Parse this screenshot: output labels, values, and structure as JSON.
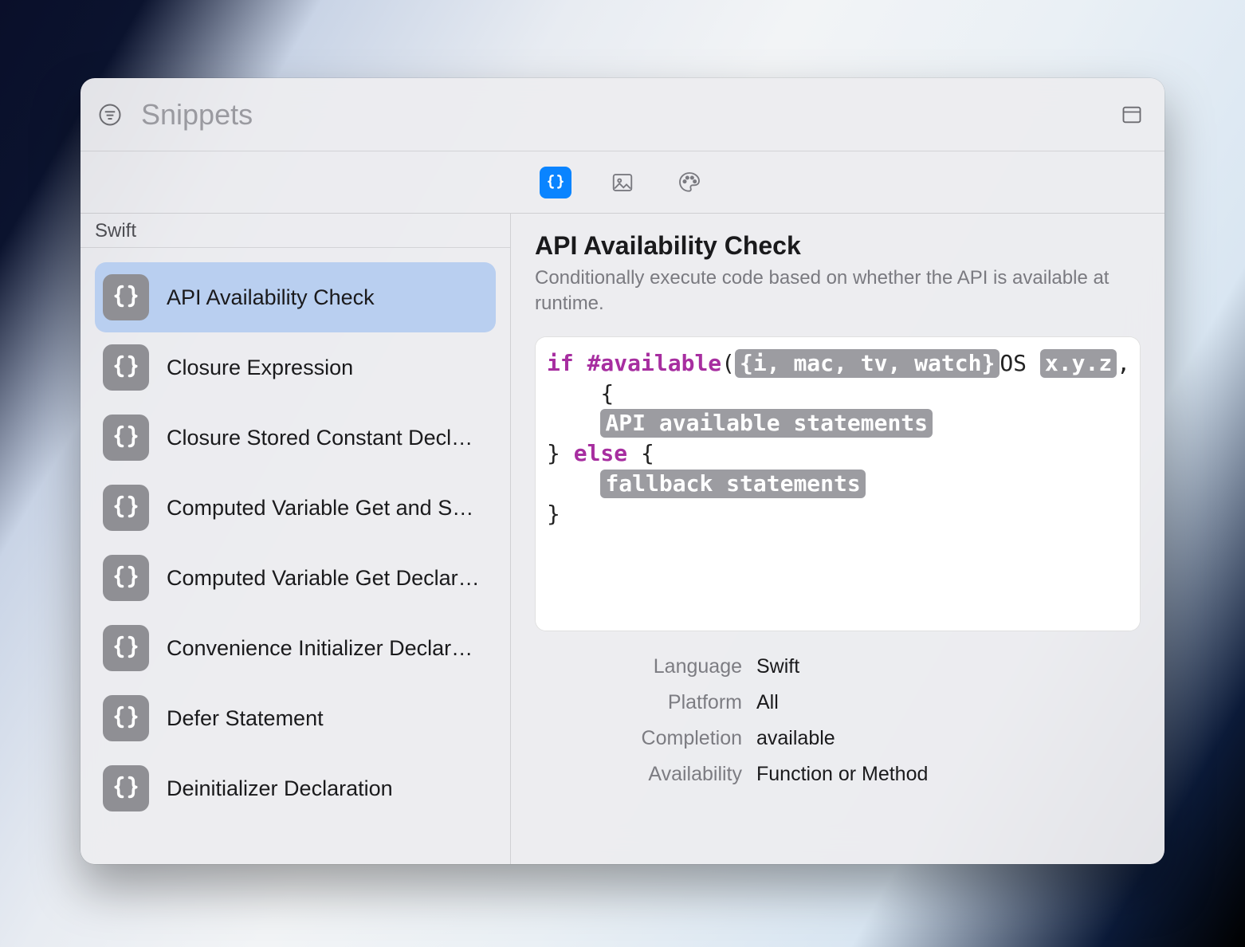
{
  "search": {
    "placeholder": "Snippets",
    "value": ""
  },
  "types": {
    "code": {
      "selected": true,
      "name": "code-snippets"
    },
    "media": {
      "selected": false,
      "name": "media-library"
    },
    "color": {
      "selected": false,
      "name": "color-library"
    }
  },
  "sidebar": {
    "section_title": "Swift",
    "items": [
      {
        "label": "API Availability Check",
        "selected": true
      },
      {
        "label": "Closure Expression",
        "selected": false
      },
      {
        "label": "Closure Stored Constant Decla…",
        "selected": false
      },
      {
        "label": "Computed Variable Get and Se…",
        "selected": false
      },
      {
        "label": "Computed Variable Get Declar…",
        "selected": false
      },
      {
        "label": "Convenience Initializer Declara…",
        "selected": false
      },
      {
        "label": "Defer Statement",
        "selected": false
      },
      {
        "label": "Deinitializer Declaration",
        "selected": false
      }
    ]
  },
  "detail": {
    "title": "API Availability Check",
    "subtitle": "Conditionally execute code based on whether the API is available at runtime.",
    "code": {
      "kw_if": "if",
      "kw_available": "#available",
      "platforms_token": "{i, mac, tv, watch}",
      "os_text": "OS ",
      "version_token": "x.y.z",
      "tail_text": ", *)",
      "open_brace_line": " {",
      "api_stm_token": "API available statements",
      "else_line_open": "} ",
      "kw_else": "else",
      "else_line_close": " {",
      "fallback_token": "fallback statements",
      "close_brace": "}"
    },
    "meta": {
      "labels": {
        "language": "Language",
        "platform": "Platform",
        "completion": "Completion",
        "availability": "Availability"
      },
      "values": {
        "language": "Swift",
        "platform": "All",
        "completion": "available",
        "availability": "Function or Method"
      }
    }
  }
}
